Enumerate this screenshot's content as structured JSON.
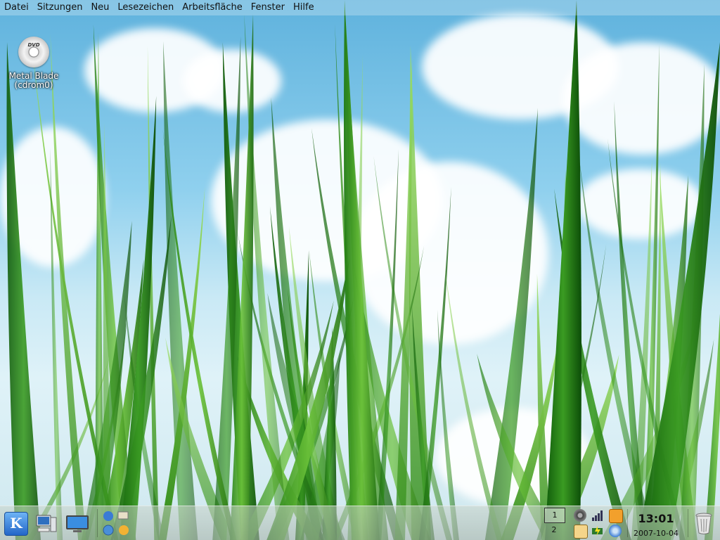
{
  "menubar": {
    "items": [
      "Datei",
      "Sitzungen",
      "Neu",
      "Lesezeichen",
      "Arbeitsfläche",
      "Fenster",
      "Hilfe"
    ]
  },
  "desktop": {
    "icons": [
      {
        "label_line1": "Metal Blade",
        "label_line2": "(cdrom0)",
        "badge": "DVD",
        "icon": "dvd-disc-icon"
      }
    ]
  },
  "panel": {
    "launchers": [
      {
        "name": "kde-menu-button",
        "glyph": "K"
      },
      {
        "name": "computer-icon"
      },
      {
        "name": "desktop-show-icon"
      },
      {
        "name": "network-apps-icon"
      }
    ],
    "pager": {
      "desktops": [
        "1",
        "2"
      ],
      "active": "1"
    },
    "tray_icons": [
      "speaker-icon",
      "network-signal-icon",
      "email-icon",
      "klipper-icon",
      "power-icon",
      "update-icon"
    ],
    "clock": {
      "time": "13:01",
      "date": "2007-10-04"
    },
    "trash_icon": "trash-icon"
  },
  "colors": {
    "sky": "#6fbde4",
    "grass": "#2f9b1c",
    "grass_light": "#8fd651",
    "kde_blue": "#2366c8"
  }
}
